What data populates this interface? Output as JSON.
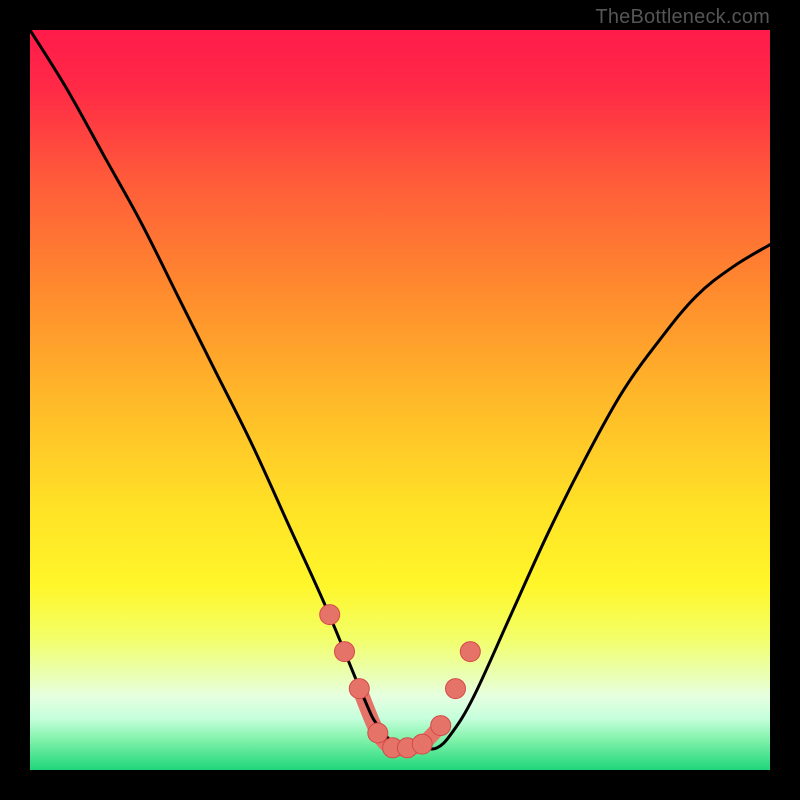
{
  "watermark": "TheBottleneck.com",
  "colors": {
    "black": "#000000",
    "curve": "#000000",
    "marker_fill": "#e57368",
    "marker_stroke": "#d34a4a",
    "gradient_stops": [
      {
        "offset": "0%",
        "color": "#ff1b4b"
      },
      {
        "offset": "8%",
        "color": "#ff2a46"
      },
      {
        "offset": "20%",
        "color": "#ff5a3a"
      },
      {
        "offset": "35%",
        "color": "#ff8a2e"
      },
      {
        "offset": "50%",
        "color": "#ffb929"
      },
      {
        "offset": "65%",
        "color": "#ffe326"
      },
      {
        "offset": "75%",
        "color": "#fff62a"
      },
      {
        "offset": "82%",
        "color": "#f3ff66"
      },
      {
        "offset": "87%",
        "color": "#eaffb0"
      },
      {
        "offset": "90%",
        "color": "#e6ffe0"
      },
      {
        "offset": "93%",
        "color": "#c6ffdc"
      },
      {
        "offset": "96%",
        "color": "#7ef2a8"
      },
      {
        "offset": "100%",
        "color": "#1fd67b"
      }
    ]
  },
  "chart_data": {
    "type": "line",
    "title": "",
    "xlabel": "",
    "ylabel": "",
    "xlim": [
      0,
      100
    ],
    "ylim": [
      0,
      100
    ],
    "series": [
      {
        "name": "bottleneck-curve",
        "x": [
          0,
          5,
          10,
          15,
          20,
          25,
          30,
          35,
          40,
          45,
          47,
          50,
          53,
          55,
          57,
          60,
          65,
          70,
          75,
          80,
          85,
          90,
          95,
          100
        ],
        "values": [
          100,
          92,
          83,
          74,
          64,
          54,
          44,
          33,
          22,
          10,
          6,
          3,
          3,
          3,
          5,
          10,
          21,
          32,
          42,
          51,
          58,
          64,
          68,
          71
        ]
      }
    ],
    "markers": {
      "name": "highlighted-points",
      "x": [
        40.5,
        42.5,
        44.5,
        47.0,
        49.0,
        51.0,
        53.0,
        55.5,
        57.5,
        59.5
      ],
      "values": [
        21.0,
        16.0,
        11.0,
        5.0,
        3.0,
        3.0,
        3.5,
        6.0,
        11.0,
        16.0
      ]
    },
    "connector": {
      "name": "marker-connector",
      "x": [
        44.5,
        47.0,
        49.0,
        51.0,
        53.0,
        55.5
      ],
      "values": [
        11.0,
        5.0,
        3.0,
        3.0,
        3.5,
        6.0
      ]
    }
  }
}
